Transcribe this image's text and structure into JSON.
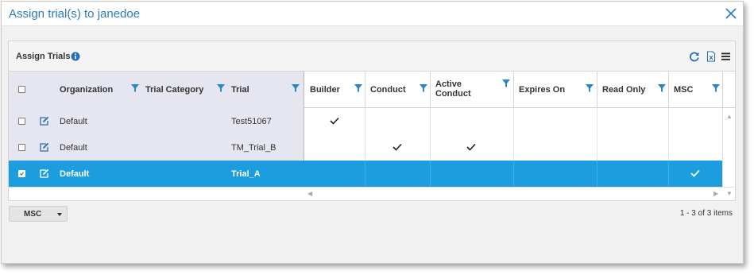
{
  "dialog": {
    "title": "Assign trial(s) to janedoe"
  },
  "panel": {
    "title": "Assign Trials",
    "tools": [
      "refresh-icon",
      "export-excel-icon",
      "menu-icon"
    ]
  },
  "columns": {
    "organization": "Organization",
    "trial_category": "Trial Category",
    "trial": "Trial",
    "builder": "Builder",
    "conduct": "Conduct",
    "active_conduct": "Active Conduct",
    "expires_on": "Expires On",
    "read_only": "Read Only",
    "msc": "MSC"
  },
  "rows": [
    {
      "selected": false,
      "organization": "Default",
      "trial_category": "",
      "trial": "Test51067",
      "builder": true,
      "conduct": false,
      "active_conduct": false,
      "expires_on": "",
      "read_only": false,
      "msc": false
    },
    {
      "selected": false,
      "organization": "Default",
      "trial_category": "",
      "trial": "TM_Trial_B",
      "builder": false,
      "conduct": true,
      "active_conduct": true,
      "expires_on": "",
      "read_only": false,
      "msc": false
    },
    {
      "selected": true,
      "organization": "Default",
      "trial_category": "",
      "trial": "Trial_A",
      "builder": false,
      "conduct": false,
      "active_conduct": false,
      "expires_on": "",
      "read_only": false,
      "msc": true
    }
  ],
  "footer": {
    "role_select": "MSC",
    "pager_info": "1 - 3 of 3 items"
  },
  "colors": {
    "accent": "#2a7bbf",
    "selected_row": "#1b9de0",
    "filter_icon": "#2a87c7"
  }
}
